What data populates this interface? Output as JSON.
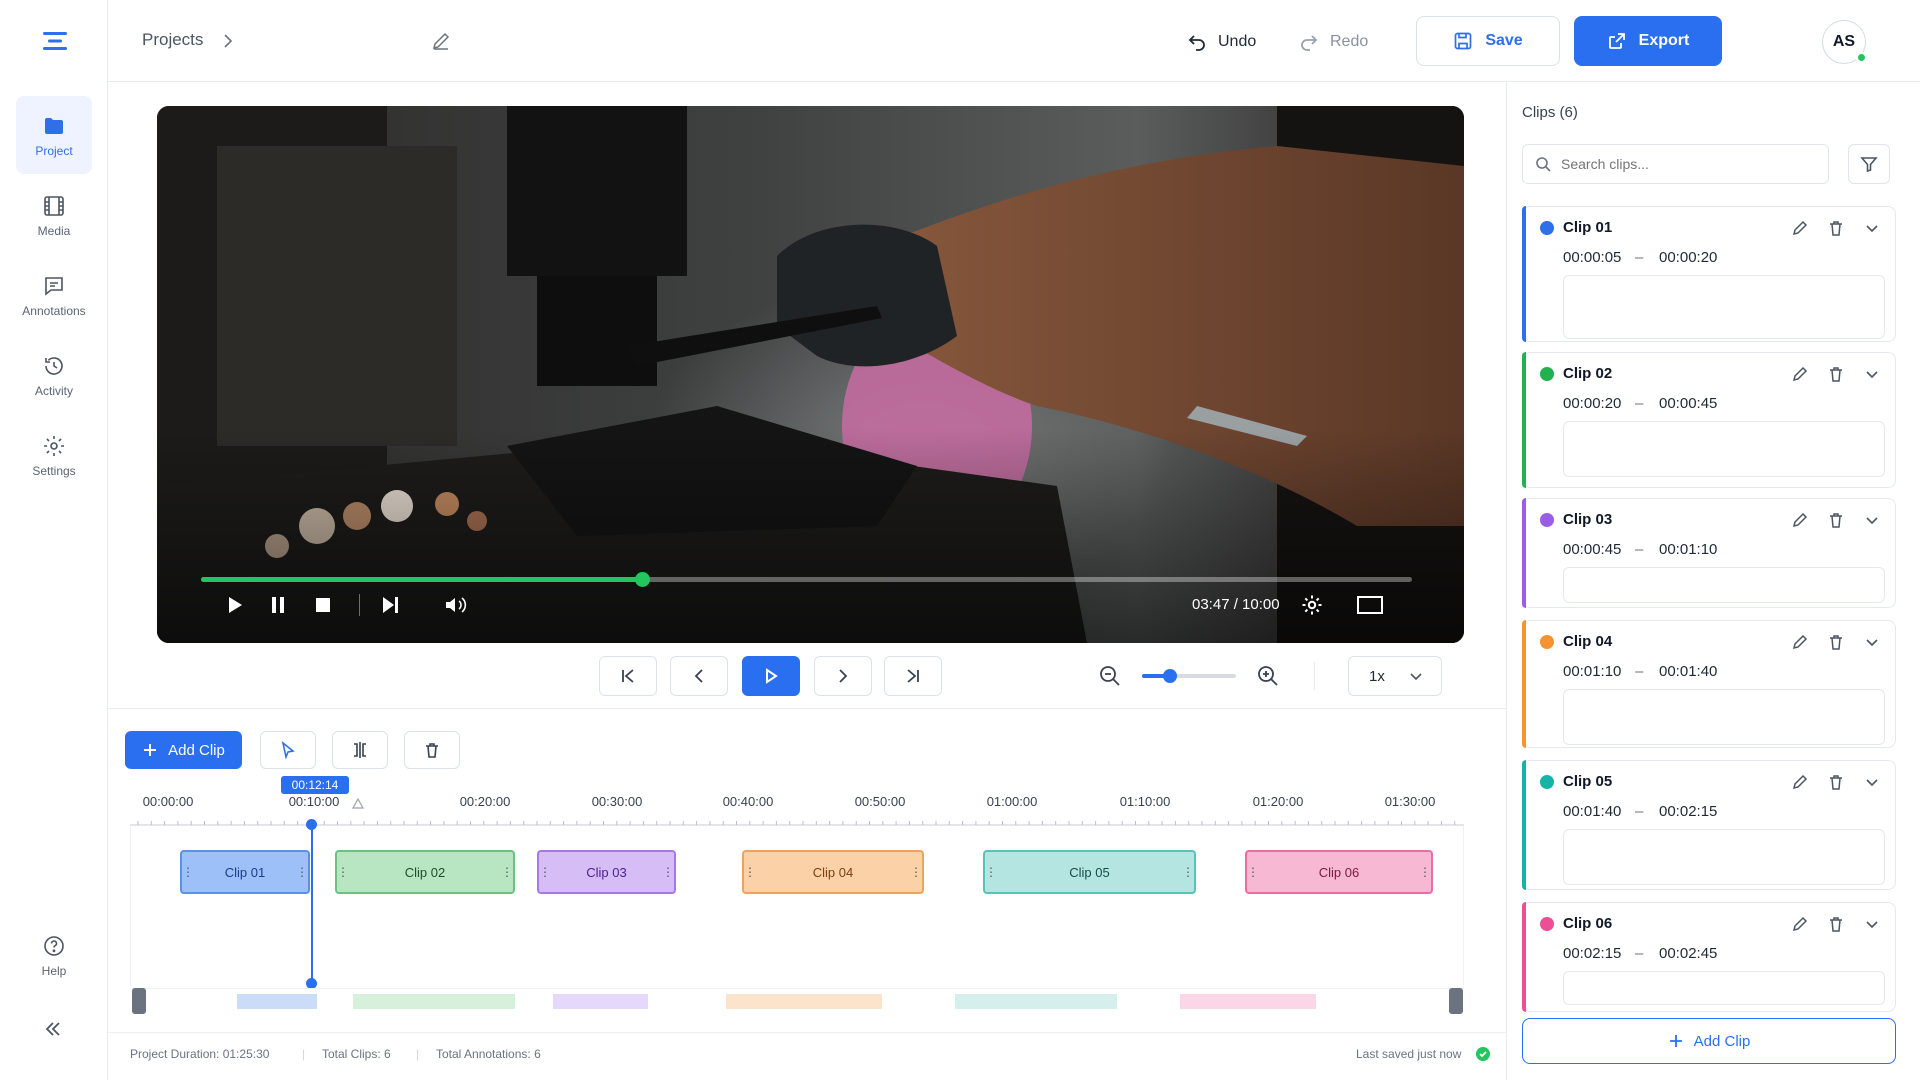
{
  "nav": {
    "items": [
      {
        "label": "Project",
        "icon": "folder-icon",
        "active": true
      },
      {
        "label": "Media",
        "icon": "film-icon"
      },
      {
        "label": "Annotations",
        "icon": "message-icon"
      },
      {
        "label": "Activity",
        "icon": "history-icon"
      },
      {
        "label": "Settings",
        "icon": "gear-icon"
      }
    ],
    "help": "Help"
  },
  "header": {
    "breadcrumb": "Projects",
    "undo": "Undo",
    "redo": "Redo",
    "save": "Save",
    "export": "Export",
    "avatar": "AS"
  },
  "player": {
    "time": "03:47 / 10:00",
    "progress": 0.364
  },
  "transport": {
    "speed": "1x",
    "zoom_level": 0.3
  },
  "timeline": {
    "add_clip": "Add Clip",
    "playhead": "00:12:14",
    "ticks": [
      "00:00:00",
      "00:10:00",
      "00:20:00",
      "00:30:00",
      "00:40:00",
      "00:50:00",
      "01:00:00",
      "01:10:00",
      "01:20:00",
      "01:30:00"
    ],
    "clips": [
      "Clip 01",
      "Clip 02",
      "Clip 03",
      "Clip 04",
      "Clip 05",
      "Clip 06"
    ]
  },
  "footer": {
    "duration": "Project Duration: 01:25:30",
    "clips": "Total Clips: 6",
    "annotations": "Total Annotations: 6",
    "saved": "Last saved just now"
  },
  "panel": {
    "title": "Clips (6)",
    "search_placeholder": "Search clips...",
    "add_clip": "Add Clip",
    "clips": [
      {
        "name": "Clip 01",
        "start": "00:00:05",
        "end": "00:00:20",
        "color": "#2f6fea"
      },
      {
        "name": "Clip 02",
        "start": "00:00:20",
        "end": "00:00:45",
        "color": "#22b14c"
      },
      {
        "name": "Clip 03",
        "start": "00:00:45",
        "end": "00:01:10",
        "color": "#9b5de5"
      },
      {
        "name": "Clip 04",
        "start": "00:01:10",
        "end": "00:01:40",
        "color": "#f59331"
      },
      {
        "name": "Clip 05",
        "start": "00:01:40",
        "end": "00:02:15",
        "color": "#18b3a8"
      },
      {
        "name": "Clip 06",
        "start": "00:02:15",
        "end": "00:02:45",
        "color": "#ec4f96"
      }
    ]
  }
}
